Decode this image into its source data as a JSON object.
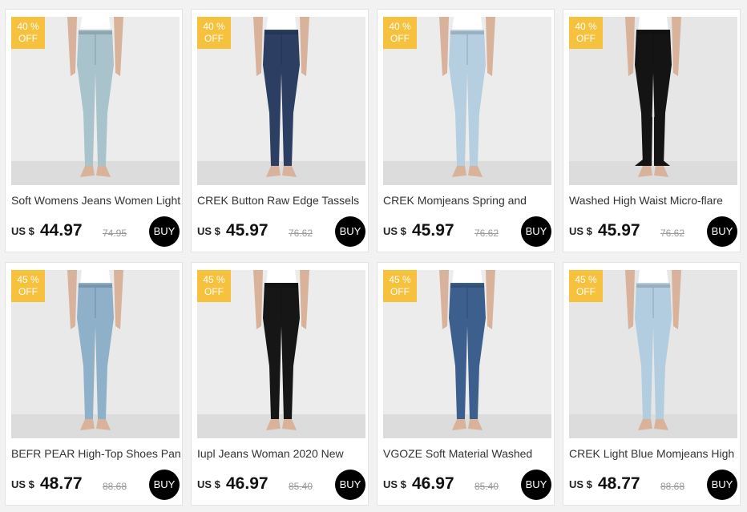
{
  "products": [
    {
      "badge_pct": "40 %",
      "badge_off": "OFF",
      "title": "Soft Womens Jeans Women Light",
      "currency": "US $",
      "price": "44.97",
      "old_price": "74.95",
      "buy": "BUY",
      "jean_color": "#a9c3cd",
      "bg": "#ececec"
    },
    {
      "badge_pct": "40 %",
      "badge_off": "OFF",
      "title": "CREK Button Raw Edge Tassels",
      "currency": "US $",
      "price": "45.97",
      "old_price": "76.62",
      "buy": "BUY",
      "jean_color": "#2c3f63",
      "bg": "#ececec"
    },
    {
      "badge_pct": "40 %",
      "badge_off": "OFF",
      "title": "CREK Momjeans Spring and",
      "currency": "US $",
      "price": "45.97",
      "old_price": "76.62",
      "buy": "BUY",
      "jean_color": "#b6cfe0",
      "bg": "#ececec"
    },
    {
      "badge_pct": "40 %",
      "badge_off": "OFF",
      "title": "Washed High Waist Micro-flare",
      "currency": "US $",
      "price": "45.97",
      "old_price": "76.62",
      "buy": "BUY",
      "jean_color": "#141414",
      "bg": "#e6e6e6"
    },
    {
      "badge_pct": "45 %",
      "badge_off": "OFF",
      "title": "BEFR PEAR High-Top Shoes Pants",
      "currency": "US $",
      "price": "48.77",
      "old_price": "88.68",
      "buy": "BUY",
      "jean_color": "#8fb0c9",
      "bg": "#e9e9e9"
    },
    {
      "badge_pct": "45 %",
      "badge_off": "OFF",
      "title": "Iupl Jeans Woman 2020 New",
      "currency": "US $",
      "price": "46.97",
      "old_price": "85.40",
      "buy": "BUY",
      "jean_color": "#161616",
      "bg": "#ececec"
    },
    {
      "badge_pct": "45 %",
      "badge_off": "OFF",
      "title": "VGOZE Soft Material Washed",
      "currency": "US $",
      "price": "46.97",
      "old_price": "85.40",
      "buy": "BUY",
      "jean_color": "#3c5f8e",
      "bg": "#ececec"
    },
    {
      "badge_pct": "45 %",
      "badge_off": "OFF",
      "title": "CREK Light Blue Momjeans High",
      "currency": "US $",
      "price": "48.77",
      "old_price": "88.68",
      "buy": "BUY",
      "jean_color": "#b3cde0",
      "bg": "#e6e6e6"
    }
  ],
  "colors": {
    "badge": "#f6c23d",
    "buy_button": "#000000",
    "skin": "#d9b29c"
  }
}
